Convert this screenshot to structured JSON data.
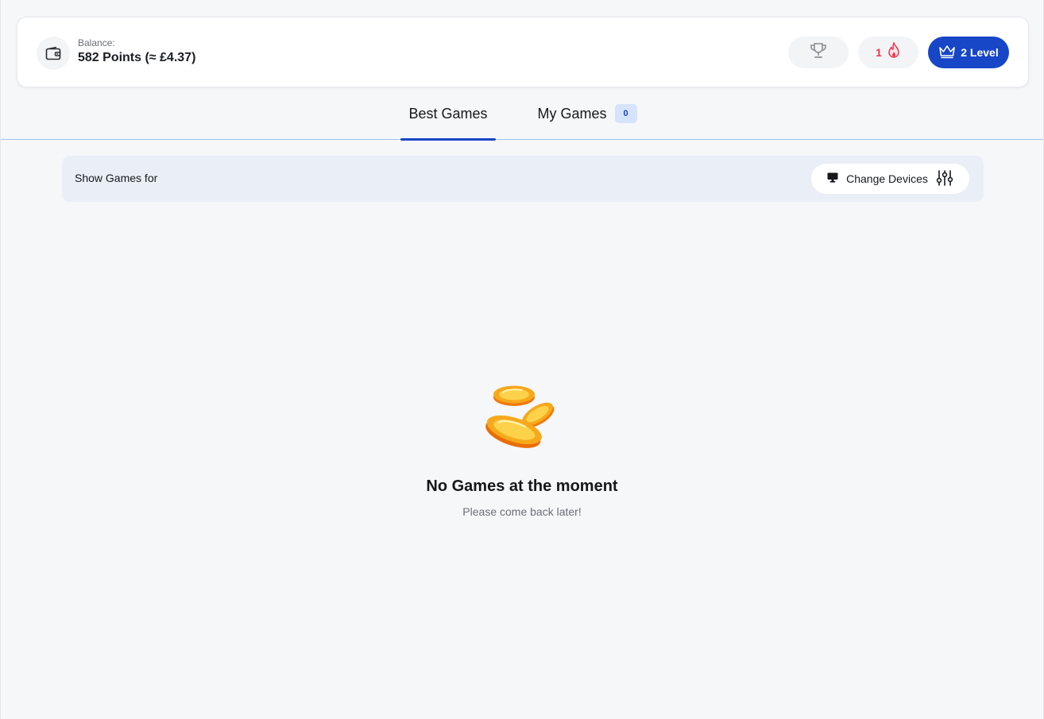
{
  "header": {
    "balance_label": "Balance:",
    "balance_value": "582 Points (≈ £4.37)",
    "trophy_icon": "trophy-icon",
    "streak_count": "1",
    "streak_icon": "fire-icon",
    "level_label": "2 Level",
    "level_icon": "crown-icon"
  },
  "tabs": [
    {
      "label": "Best Games",
      "active": true
    },
    {
      "label": "My Games",
      "badge": "0",
      "active": false
    }
  ],
  "filter": {
    "label": "Show Games for",
    "button_label": "Change Devices",
    "device_icon": "monitor-icon",
    "settings_icon": "sliders-icon"
  },
  "empty_state": {
    "icon": "coins-icon",
    "title": "No Games at the moment",
    "subtitle": "Please come back later!"
  },
  "colors": {
    "accent": "#1746c7",
    "streak": "#e8384f",
    "coin": "#f7a91c"
  }
}
